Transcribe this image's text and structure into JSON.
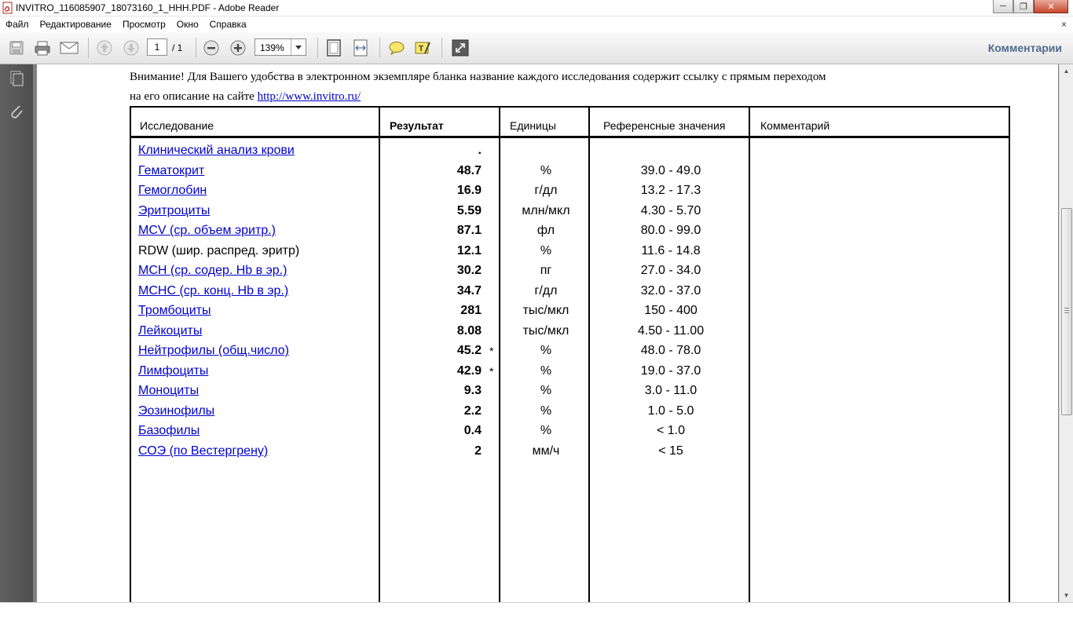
{
  "window": {
    "title": "INVITRO_116085907_18073160_1_HHH.PDF - Adobe Reader",
    "buttons": {
      "minimize": "─",
      "maximize": "❐",
      "close": "✕"
    }
  },
  "menu": {
    "items": [
      "Файл",
      "Редактирование",
      "Просмотр",
      "Окно",
      "Справка"
    ],
    "close_glyph": "×"
  },
  "toolbar": {
    "page_current": "1",
    "page_total": "/ 1",
    "zoom": "139%",
    "comments_label": "Комментарии",
    "icons": [
      "save-icon",
      "print-icon",
      "email-icon",
      "page-up-icon",
      "page-down-icon",
      "zoom-out-icon",
      "zoom-in-icon",
      "fit-page-icon",
      "fit-width-icon",
      "comment-icon",
      "highlight-icon",
      "fullscreen-icon"
    ]
  },
  "document": {
    "notice_line1": "Внимание! Для Вашего удобства в электронном экземпляре бланка название каждого исследования содержит ссылку с прямым переходом",
    "notice_line2_prefix": "на его описание на сайте ",
    "notice_link": "http://www.invitro.ru/",
    "table": {
      "headers": {
        "study": "Исследование",
        "result": "Результат",
        "units": "Единицы",
        "reference": "Референсные значения",
        "comment": "Комментарий"
      },
      "rows": [
        {
          "name": "Клинический анализ крови",
          "result": ".",
          "flag": "",
          "unit": "",
          "ref": "",
          "link": true
        },
        {
          "name": "Гематокрит",
          "result": "48.7",
          "flag": "",
          "unit": "%",
          "ref": "39.0 - 49.0",
          "link": true
        },
        {
          "name": "Гемоглобин",
          "result": "16.9",
          "flag": "",
          "unit": "г/дл",
          "ref": "13.2 - 17.3",
          "link": true
        },
        {
          "name": "Эритроциты",
          "result": "5.59",
          "flag": "",
          "unit": "млн/мкл",
          "ref": "4.30 - 5.70",
          "link": true
        },
        {
          "name": "MCV (ср. объем эритр.)",
          "result": "87.1",
          "flag": "",
          "unit": "фл",
          "ref": "80.0 - 99.0",
          "link": true
        },
        {
          "name": "RDW (шир. распред. эритр)",
          "result": "12.1",
          "flag": "",
          "unit": "%",
          "ref": "11.6 - 14.8",
          "link": false
        },
        {
          "name": "MCH (ср. содер. Hb в эр.)",
          "result": "30.2",
          "flag": "",
          "unit": "пг",
          "ref": "27.0 - 34.0",
          "link": true
        },
        {
          "name": "MCHC (ср. конц. Hb в эр.)",
          "result": "34.7",
          "flag": "",
          "unit": "г/дл",
          "ref": "32.0 - 37.0",
          "link": true
        },
        {
          "name": "Тромбоциты",
          "result": "281",
          "flag": "",
          "unit": "тыс/мкл",
          "ref": "150 - 400",
          "link": true
        },
        {
          "name": "Лейкоциты",
          "result": "8.08",
          "flag": "",
          "unit": "тыс/мкл",
          "ref": "4.50 - 11.00",
          "link": true
        },
        {
          "name": "Нейтрофилы (общ.число)",
          "result": "45.2",
          "flag": "*",
          "unit": "%",
          "ref": "48.0 - 78.0",
          "link": true
        },
        {
          "name": "Лимфоциты",
          "result": "42.9",
          "flag": "*",
          "unit": "%",
          "ref": "19.0 - 37.0",
          "link": true
        },
        {
          "name": "Моноциты",
          "result": "9.3",
          "flag": "",
          "unit": "%",
          "ref": "3.0 - 11.0",
          "link": true
        },
        {
          "name": "Эозинофилы",
          "result": "2.2",
          "flag": "",
          "unit": "%",
          "ref": "1.0 - 5.0",
          "link": true
        },
        {
          "name": "Базофилы",
          "result": "0.4",
          "flag": "",
          "unit": "%",
          "ref": "< 1.0",
          "link": true
        },
        {
          "name": "СОЭ (по Вестергрену)",
          "result": "2",
          "flag": "",
          "unit": "мм/ч",
          "ref": "< 15",
          "link": true
        }
      ]
    }
  },
  "colors": {
    "link": "#0000cc",
    "comments": "#506b8e",
    "pane": "#555555"
  }
}
